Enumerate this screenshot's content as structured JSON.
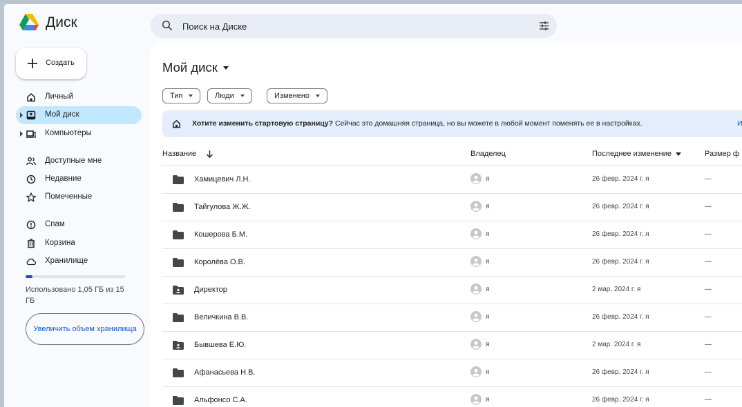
{
  "app": {
    "name": "Диск"
  },
  "search": {
    "placeholder": "Поиск на Диске"
  },
  "sidebar": {
    "create_label": "Создать",
    "items": [
      {
        "label": "Личный",
        "icon": "home-icon"
      },
      {
        "label": "Мой диск",
        "icon": "drive-icon",
        "active": true
      },
      {
        "label": "Компьютеры",
        "icon": "computer-icon"
      },
      {
        "label": "Доступные мне",
        "icon": "people-icon"
      },
      {
        "label": "Недавние",
        "icon": "clock-icon"
      },
      {
        "label": "Помеченные",
        "icon": "star-icon"
      },
      {
        "label": "Спам",
        "icon": "spam-icon"
      },
      {
        "label": "Корзина",
        "icon": "trash-icon"
      },
      {
        "label": "Хранилище",
        "icon": "cloud-icon"
      }
    ],
    "storage": {
      "used_fraction": 0.07,
      "text": "Использовано 1,05 ГБ из 15 ГБ"
    },
    "upgrade_label": "Увеличить объем хранилища"
  },
  "main": {
    "title": "Мой диск",
    "filters": [
      "Тип",
      "Люди",
      "Изменено"
    ],
    "banner": {
      "bold": "Хотите изменить стартовую страницу?",
      "text": " Сейчас это домашняя страница, но вы можете в любой момент поменять ее в настройках.",
      "link": "Из"
    },
    "columns": {
      "name": "Название",
      "owner": "Владелец",
      "modified": "Последнее изменение",
      "size": "Размер ф"
    },
    "rows": [
      {
        "name": "Хамицевич Л.Н.",
        "owner": "я",
        "modified": "26 февр. 2024 г. я",
        "size": "—",
        "shared": false
      },
      {
        "name": "Тайгулова Ж.Ж.",
        "owner": "я",
        "modified": "26 февр. 2024 г. я",
        "size": "—",
        "shared": false
      },
      {
        "name": "Кошерова Б.М.",
        "owner": "я",
        "modified": "26 февр. 2024 г. я",
        "size": "—",
        "shared": false
      },
      {
        "name": "Королёва О.В.",
        "owner": "я",
        "modified": "26 февр. 2024 г. я",
        "size": "—",
        "shared": false
      },
      {
        "name": "Директор",
        "owner": "я",
        "modified": "2 мар. 2024 г. я",
        "size": "—",
        "shared": true
      },
      {
        "name": "Величкина В.В.",
        "owner": "я",
        "modified": "26 февр. 2024 г. я",
        "size": "—",
        "shared": false
      },
      {
        "name": "Бывшева Е.Ю.",
        "owner": "я",
        "modified": "2 мар. 2024 г. я",
        "size": "—",
        "shared": true
      },
      {
        "name": "Афанасьева Н.В.",
        "owner": "я",
        "modified": "26 февр. 2024 г. я",
        "size": "—",
        "shared": false
      },
      {
        "name": "Альфонсо С.А.",
        "owner": "я",
        "modified": "26 февр. 2024 г. я",
        "size": "—",
        "shared": false
      }
    ]
  },
  "colors": {
    "accent": "#0b57d0",
    "active_nav": "#c2e7ff",
    "banner_bg": "#e3edfb"
  }
}
